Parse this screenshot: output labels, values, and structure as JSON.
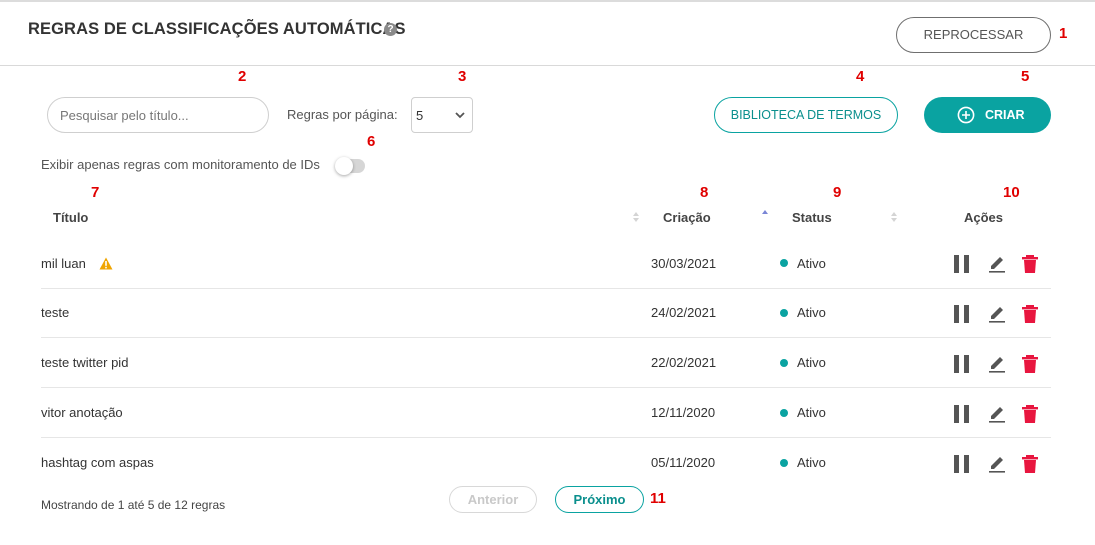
{
  "header": {
    "title": "REGRAS DE CLASSIFICAÇÕES AUTOMÁTICAS",
    "help_icon": "?",
    "reprocess_label": "REPROCESSAR"
  },
  "markers": [
    "1",
    "2",
    "3",
    "4",
    "5",
    "6",
    "7",
    "8",
    "9",
    "10",
    "11"
  ],
  "toolbar": {
    "search_placeholder": "Pesquisar pelo título...",
    "per_page_label": "Regras por página:",
    "per_page_value": "5",
    "library_label": "BIBLIOTECA DE TERMOS",
    "create_label": "CRIAR",
    "toggle_label": "Exibir apenas regras com monitoramento de IDs"
  },
  "table": {
    "columns": [
      "Título",
      "Criação",
      "Status",
      "Ações"
    ],
    "rows": [
      {
        "title": "mil luan",
        "created": "30/03/2021",
        "status": "Ativo"
      },
      {
        "title": "teste",
        "created": "24/02/2021",
        "status": "Ativo"
      },
      {
        "title": "teste twitter pid",
        "created": "22/02/2021",
        "status": "Ativo"
      },
      {
        "title": "vitor anotação",
        "created": "12/11/2020",
        "status": "Ativo"
      },
      {
        "title": "hashtag com aspas",
        "created": "05/11/2020",
        "status": "Ativo"
      }
    ]
  },
  "footer": {
    "info": "Mostrando de 1 até 5 de 12 regras",
    "prev_label": "Anterior",
    "next_label": "Próximo"
  },
  "colors": {
    "accent": "#0aa3a1",
    "marker": "#e00000",
    "delete": "#e8163f",
    "warning": "#f0a500"
  },
  "icons": [
    "help-icon",
    "chevron-down-icon",
    "plus-circle-icon",
    "sort-icon",
    "sort-asc-icon",
    "warning-icon",
    "pause-icon",
    "edit-icon",
    "trash-icon"
  ]
}
